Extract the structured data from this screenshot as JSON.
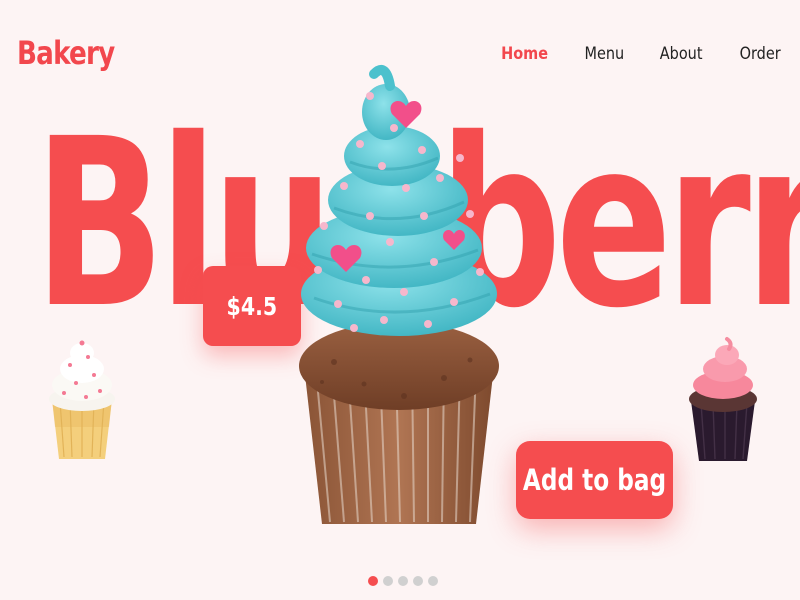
{
  "brand": {
    "name": "Bakery",
    "color": "#f2474d"
  },
  "nav": {
    "items": [
      {
        "label": "Home",
        "active": true
      },
      {
        "label": "Menu",
        "active": false
      },
      {
        "label": "About",
        "active": false
      },
      {
        "label": "Order",
        "active": false
      }
    ]
  },
  "hero": {
    "title": "Blueberry",
    "price": "$4.5",
    "cta_label": "Add to bag"
  },
  "carousel": {
    "slide_count": 5,
    "active_index": 0
  },
  "colors": {
    "accent": "#f54d4f",
    "background": "#fdf4f4",
    "frosting": "#5ec9d2",
    "sprinkle": "#f6b7cc"
  }
}
